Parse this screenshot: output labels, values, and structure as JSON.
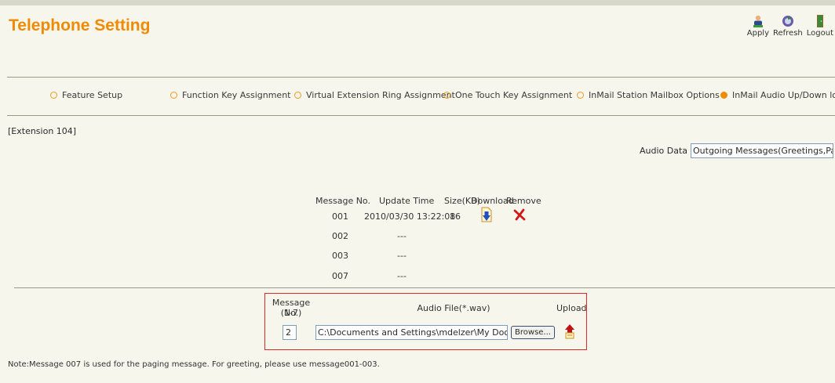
{
  "header": {
    "title": "Telephone Setting",
    "toolbar": [
      {
        "label": "Apply",
        "icon": "apply-icon"
      },
      {
        "label": "Refresh",
        "icon": "refresh-icon"
      },
      {
        "label": "Logout",
        "icon": "logout-icon"
      }
    ]
  },
  "tabs": [
    {
      "label": "Feature Setup",
      "active": false
    },
    {
      "label": "Function Key Assignment",
      "active": false
    },
    {
      "label": "Virtual Extension Ring Assignment",
      "active": false
    },
    {
      "label": "One Touch Key Assignment",
      "active": false
    },
    {
      "label": "InMail Station Mailbox Options",
      "active": false
    },
    {
      "label": "InMail Audio Up/Down load",
      "active": true
    }
  ],
  "extension_label": "[Extension 104]",
  "audio_data": {
    "label": "Audio Data",
    "selected": "Outgoing Messages(Greetings,Paging)"
  },
  "messages": {
    "headers": {
      "message_no": "Message No.",
      "update_time": "Update Time",
      "size": "Size(KB)",
      "download": "Download",
      "remove": "Remove"
    },
    "rows": [
      {
        "no": "001",
        "time": "2010/03/30 13:22:08",
        "size": "16",
        "has_file": true
      },
      {
        "no": "002",
        "time": "---",
        "size": "",
        "has_file": false
      },
      {
        "no": "003",
        "time": "---",
        "size": "",
        "has_file": false
      },
      {
        "no": "007",
        "time": "---",
        "size": "",
        "has_file": false
      }
    ]
  },
  "upload": {
    "message_no_label": "Message No.",
    "message_no_range": "(1-7)",
    "audio_file_label": "Audio File(*.wav)",
    "upload_label": "Upload",
    "message_no_value": "2",
    "file_path": "C:\\Documents and Settings\\mdelzer\\My Documents\\VM",
    "browse_label": "Browse..."
  },
  "note": "Note:Message 007 is used for the paging message. For greeting, please use message001-003.",
  "colors": {
    "accent": "#f08a00",
    "box_border": "#e0282a",
    "background": "#f6f6ec"
  }
}
